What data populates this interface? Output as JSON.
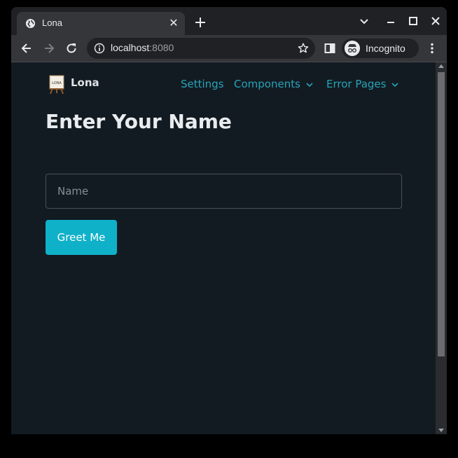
{
  "browser": {
    "tab_title": "Lona",
    "url_host": "localhost",
    "url_port": ":8080",
    "profile_label": "Incognito"
  },
  "navbar": {
    "brand_name": "Lona",
    "brand_logo_text": "LONA",
    "links": [
      {
        "label": "Settings",
        "has_dropdown": false
      },
      {
        "label": "Components",
        "has_dropdown": true
      },
      {
        "label": "Error Pages",
        "has_dropdown": true
      }
    ]
  },
  "main": {
    "title": "Enter Your Name",
    "name_input": {
      "placeholder": "Name",
      "value": ""
    },
    "greet_button_label": "Greet Me"
  },
  "colors": {
    "page_bg": "#131b22",
    "link": "#26a3b8",
    "button_bg": "#0fb1c9",
    "heading": "#e9ecef"
  }
}
